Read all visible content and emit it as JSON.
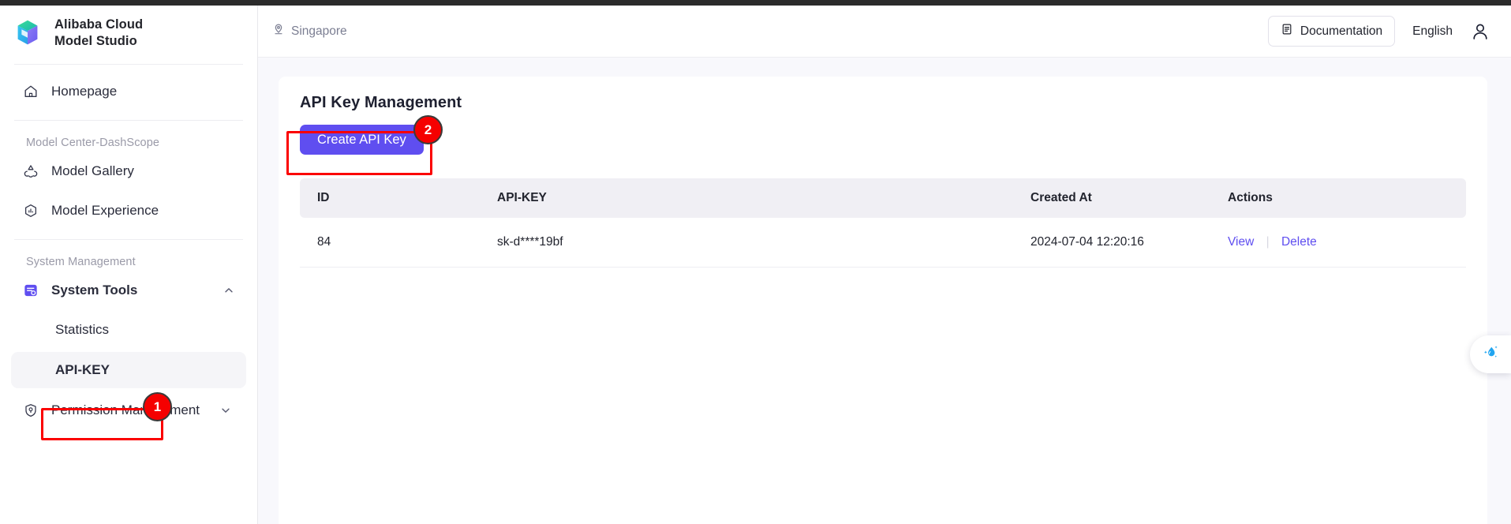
{
  "brand": {
    "line1": "Alibaba Cloud",
    "line2": "Model Studio",
    "logo_icon": "cube-logo-icon"
  },
  "header": {
    "region": {
      "label": "Singapore",
      "icon": "location-pin-icon"
    },
    "documentation": {
      "label": "Documentation",
      "icon": "document-icon"
    },
    "language": "English",
    "avatar_icon": "user-avatar-icon"
  },
  "sidebar": {
    "homepage": {
      "label": "Homepage",
      "icon": "home-icon"
    },
    "group_model": {
      "title": "Model Center-DashScope"
    },
    "model_gallery": {
      "label": "Model Gallery",
      "icon": "gallery-icon"
    },
    "model_experience": {
      "label": "Model Experience",
      "icon": "hexagon-chart-icon"
    },
    "group_system": {
      "title": "System Management"
    },
    "system_tools": {
      "label": "System Tools",
      "icon": "system-tools-icon",
      "chevron": "chevron-up-icon"
    },
    "statistics": {
      "label": "Statistics"
    },
    "api_key": {
      "label": "API-KEY"
    },
    "permission_management": {
      "label": "Permission Management",
      "icon": "shield-icon",
      "chevron": "chevron-down-icon"
    }
  },
  "main": {
    "title": "API Key Management",
    "create_button": "Create API Key",
    "table": {
      "columns": [
        "ID",
        "API-KEY",
        "Created At",
        "Actions"
      ],
      "rows": [
        {
          "id": "84",
          "api_key": "sk-d****19bf",
          "created_at": "2024-07-04 12:20:16",
          "actions": {
            "view": "View",
            "delete": "Delete"
          }
        }
      ]
    }
  },
  "floating_widget": {
    "icon": "water-drop-sparkle-icon"
  },
  "annotations": {
    "step1": "1",
    "step2": "2"
  },
  "colors": {
    "accent_purple": "#5f4ef0",
    "annotation_red": "#fb0000",
    "table_header_bg": "#f0eff4",
    "content_bg": "#f8f8fc"
  }
}
